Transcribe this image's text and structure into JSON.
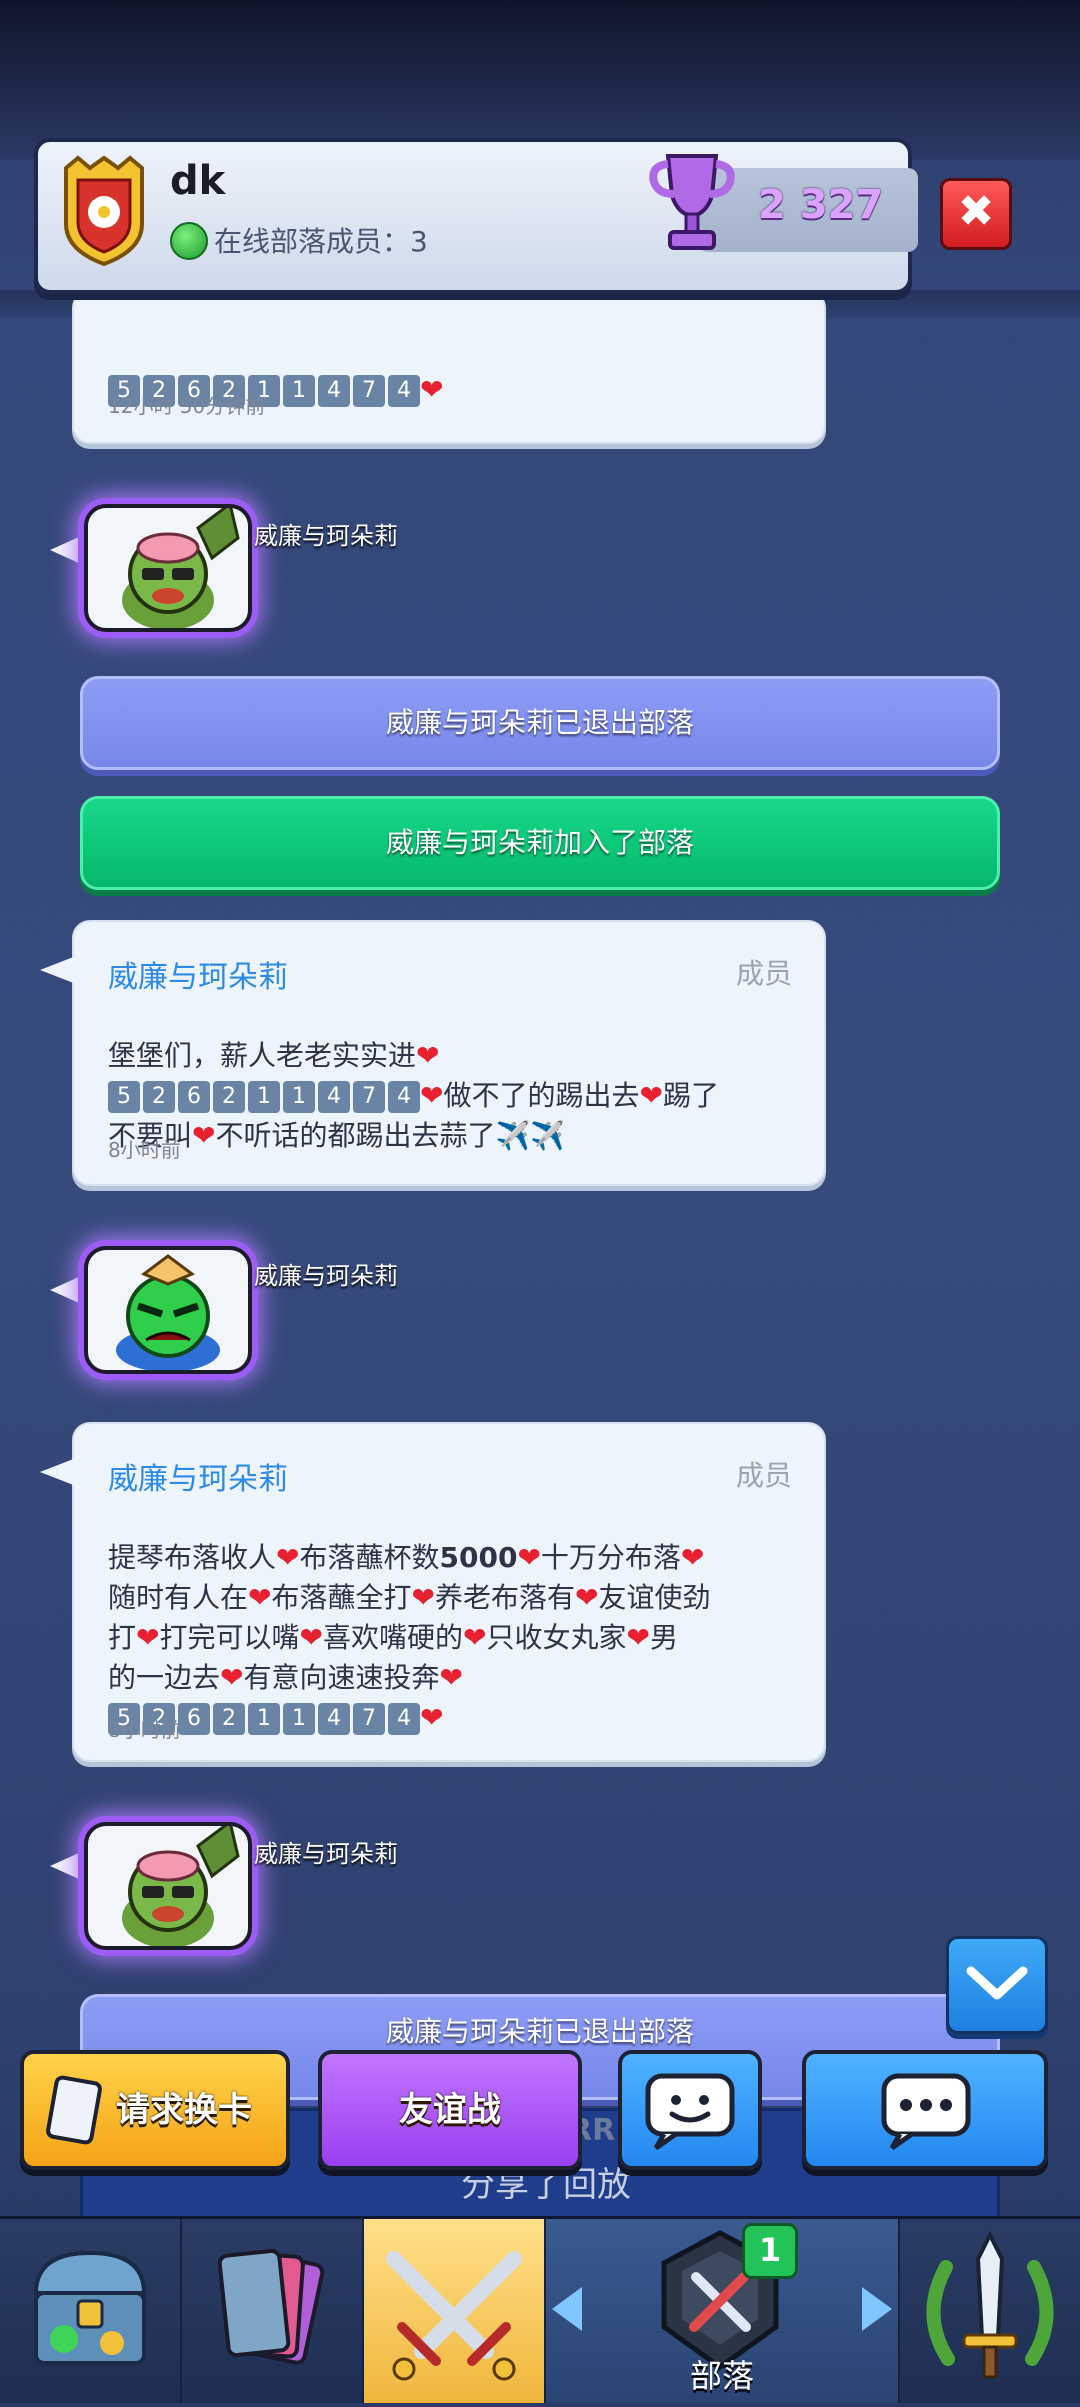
{
  "header": {
    "clan_name": "dk",
    "online_text": "在线部落成员：3",
    "trophies": "2 327",
    "close_label": "✖"
  },
  "messages": {
    "top_partial": {
      "nums": [
        "5",
        "2",
        "6",
        "2",
        "1",
        "1",
        "4",
        "7",
        "4"
      ],
      "time": "12小时 50分钟前"
    },
    "emote1": {
      "name": "威廉与珂朵莉"
    },
    "system_leave": "威廉与珂朵莉已退出部落",
    "system_join": "威廉与珂朵莉加入了部落",
    "msg1": {
      "author": "威廉与珂朵莉",
      "role": "成员",
      "line1": "堡堡们，薪人老老实实进",
      "nums": [
        "5",
        "2",
        "6",
        "2",
        "1",
        "1",
        "4",
        "7",
        "4"
      ],
      "line2_after": "做不了的踢出去",
      "line2_end": "踢了",
      "line3a": "不要叫",
      "line3b": "不听话的都踢出去蒜了✈️✈️",
      "time": "8小时前"
    },
    "emote2": {
      "name": "威廉与珂朵莉"
    },
    "msg2": {
      "author": "威廉与珂朵莉",
      "role": "成员",
      "l1a": "提琴布落收人",
      "l1b": "布落蘸杯数",
      "l1num": "5000",
      "l1c": "十万分布落",
      "l2a": "随时有人在",
      "l2b": "布落蘸全打",
      "l2c": "养老布落有",
      "l2d": "友谊使劲",
      "l3a": "打",
      "l3b": "打完可以嘴",
      "l3c": "喜欢嘴硬的",
      "l3d": "只收女丸家",
      "l3e": "男",
      "l4a": "的一边去",
      "l4b": "有意向速速投奔",
      "nums": [
        "5",
        "2",
        "6",
        "2",
        "1",
        "1",
        "4",
        "7",
        "4"
      ],
      "time": "8小时前"
    },
    "emote3": {
      "name": "威廉与珂朵莉"
    },
    "system_leave2": "威廉与珂朵莉已退出部落",
    "replay_partial_name": "RR",
    "replay_partial_text": "分享了回放"
  },
  "actions": {
    "request_label": "请求换卡",
    "friendly_label": "友谊战",
    "emote_label": "emote",
    "chat_label": "chat"
  },
  "nav": {
    "clan_label": "部落",
    "clan_badge": "1"
  },
  "colors": {
    "author": "#2d8be8",
    "heart": "#e8202f",
    "leave_banner": "#8594f2",
    "join_banner": "#0fcc7c"
  }
}
